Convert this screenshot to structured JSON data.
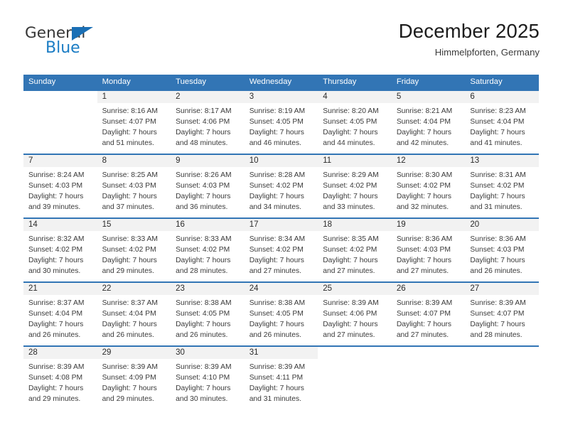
{
  "brand": {
    "name_part1": "General",
    "name_part2": "Blue",
    "accent_color": "#1a7cc4"
  },
  "header": {
    "title": "December 2025",
    "subtitle": "Himmelpforten, Germany"
  },
  "theme": {
    "header_blue": "#3275b5",
    "daynum_band": "#f2f2f2",
    "text": "#3a3a3a"
  },
  "weekday_headers": [
    "Sunday",
    "Monday",
    "Tuesday",
    "Wednesday",
    "Thursday",
    "Friday",
    "Saturday"
  ],
  "weeks": [
    [
      {
        "day": "",
        "sunrise": "",
        "sunset": "",
        "daylight1": "",
        "daylight2": ""
      },
      {
        "day": "1",
        "sunrise": "Sunrise: 8:16 AM",
        "sunset": "Sunset: 4:07 PM",
        "daylight1": "Daylight: 7 hours",
        "daylight2": "and 51 minutes."
      },
      {
        "day": "2",
        "sunrise": "Sunrise: 8:17 AM",
        "sunset": "Sunset: 4:06 PM",
        "daylight1": "Daylight: 7 hours",
        "daylight2": "and 48 minutes."
      },
      {
        "day": "3",
        "sunrise": "Sunrise: 8:19 AM",
        "sunset": "Sunset: 4:05 PM",
        "daylight1": "Daylight: 7 hours",
        "daylight2": "and 46 minutes."
      },
      {
        "day": "4",
        "sunrise": "Sunrise: 8:20 AM",
        "sunset": "Sunset: 4:05 PM",
        "daylight1": "Daylight: 7 hours",
        "daylight2": "and 44 minutes."
      },
      {
        "day": "5",
        "sunrise": "Sunrise: 8:21 AM",
        "sunset": "Sunset: 4:04 PM",
        "daylight1": "Daylight: 7 hours",
        "daylight2": "and 42 minutes."
      },
      {
        "day": "6",
        "sunrise": "Sunrise: 8:23 AM",
        "sunset": "Sunset: 4:04 PM",
        "daylight1": "Daylight: 7 hours",
        "daylight2": "and 41 minutes."
      }
    ],
    [
      {
        "day": "7",
        "sunrise": "Sunrise: 8:24 AM",
        "sunset": "Sunset: 4:03 PM",
        "daylight1": "Daylight: 7 hours",
        "daylight2": "and 39 minutes."
      },
      {
        "day": "8",
        "sunrise": "Sunrise: 8:25 AM",
        "sunset": "Sunset: 4:03 PM",
        "daylight1": "Daylight: 7 hours",
        "daylight2": "and 37 minutes."
      },
      {
        "day": "9",
        "sunrise": "Sunrise: 8:26 AM",
        "sunset": "Sunset: 4:03 PM",
        "daylight1": "Daylight: 7 hours",
        "daylight2": "and 36 minutes."
      },
      {
        "day": "10",
        "sunrise": "Sunrise: 8:28 AM",
        "sunset": "Sunset: 4:02 PM",
        "daylight1": "Daylight: 7 hours",
        "daylight2": "and 34 minutes."
      },
      {
        "day": "11",
        "sunrise": "Sunrise: 8:29 AM",
        "sunset": "Sunset: 4:02 PM",
        "daylight1": "Daylight: 7 hours",
        "daylight2": "and 33 minutes."
      },
      {
        "day": "12",
        "sunrise": "Sunrise: 8:30 AM",
        "sunset": "Sunset: 4:02 PM",
        "daylight1": "Daylight: 7 hours",
        "daylight2": "and 32 minutes."
      },
      {
        "day": "13",
        "sunrise": "Sunrise: 8:31 AM",
        "sunset": "Sunset: 4:02 PM",
        "daylight1": "Daylight: 7 hours",
        "daylight2": "and 31 minutes."
      }
    ],
    [
      {
        "day": "14",
        "sunrise": "Sunrise: 8:32 AM",
        "sunset": "Sunset: 4:02 PM",
        "daylight1": "Daylight: 7 hours",
        "daylight2": "and 30 minutes."
      },
      {
        "day": "15",
        "sunrise": "Sunrise: 8:33 AM",
        "sunset": "Sunset: 4:02 PM",
        "daylight1": "Daylight: 7 hours",
        "daylight2": "and 29 minutes."
      },
      {
        "day": "16",
        "sunrise": "Sunrise: 8:33 AM",
        "sunset": "Sunset: 4:02 PM",
        "daylight1": "Daylight: 7 hours",
        "daylight2": "and 28 minutes."
      },
      {
        "day": "17",
        "sunrise": "Sunrise: 8:34 AM",
        "sunset": "Sunset: 4:02 PM",
        "daylight1": "Daylight: 7 hours",
        "daylight2": "and 27 minutes."
      },
      {
        "day": "18",
        "sunrise": "Sunrise: 8:35 AM",
        "sunset": "Sunset: 4:02 PM",
        "daylight1": "Daylight: 7 hours",
        "daylight2": "and 27 minutes."
      },
      {
        "day": "19",
        "sunrise": "Sunrise: 8:36 AM",
        "sunset": "Sunset: 4:03 PM",
        "daylight1": "Daylight: 7 hours",
        "daylight2": "and 27 minutes."
      },
      {
        "day": "20",
        "sunrise": "Sunrise: 8:36 AM",
        "sunset": "Sunset: 4:03 PM",
        "daylight1": "Daylight: 7 hours",
        "daylight2": "and 26 minutes."
      }
    ],
    [
      {
        "day": "21",
        "sunrise": "Sunrise: 8:37 AM",
        "sunset": "Sunset: 4:04 PM",
        "daylight1": "Daylight: 7 hours",
        "daylight2": "and 26 minutes."
      },
      {
        "day": "22",
        "sunrise": "Sunrise: 8:37 AM",
        "sunset": "Sunset: 4:04 PM",
        "daylight1": "Daylight: 7 hours",
        "daylight2": "and 26 minutes."
      },
      {
        "day": "23",
        "sunrise": "Sunrise: 8:38 AM",
        "sunset": "Sunset: 4:05 PM",
        "daylight1": "Daylight: 7 hours",
        "daylight2": "and 26 minutes."
      },
      {
        "day": "24",
        "sunrise": "Sunrise: 8:38 AM",
        "sunset": "Sunset: 4:05 PM",
        "daylight1": "Daylight: 7 hours",
        "daylight2": "and 26 minutes."
      },
      {
        "day": "25",
        "sunrise": "Sunrise: 8:39 AM",
        "sunset": "Sunset: 4:06 PM",
        "daylight1": "Daylight: 7 hours",
        "daylight2": "and 27 minutes."
      },
      {
        "day": "26",
        "sunrise": "Sunrise: 8:39 AM",
        "sunset": "Sunset: 4:07 PM",
        "daylight1": "Daylight: 7 hours",
        "daylight2": "and 27 minutes."
      },
      {
        "day": "27",
        "sunrise": "Sunrise: 8:39 AM",
        "sunset": "Sunset: 4:07 PM",
        "daylight1": "Daylight: 7 hours",
        "daylight2": "and 28 minutes."
      }
    ],
    [
      {
        "day": "28",
        "sunrise": "Sunrise: 8:39 AM",
        "sunset": "Sunset: 4:08 PM",
        "daylight1": "Daylight: 7 hours",
        "daylight2": "and 29 minutes."
      },
      {
        "day": "29",
        "sunrise": "Sunrise: 8:39 AM",
        "sunset": "Sunset: 4:09 PM",
        "daylight1": "Daylight: 7 hours",
        "daylight2": "and 29 minutes."
      },
      {
        "day": "30",
        "sunrise": "Sunrise: 8:39 AM",
        "sunset": "Sunset: 4:10 PM",
        "daylight1": "Daylight: 7 hours",
        "daylight2": "and 30 minutes."
      },
      {
        "day": "31",
        "sunrise": "Sunrise: 8:39 AM",
        "sunset": "Sunset: 4:11 PM",
        "daylight1": "Daylight: 7 hours",
        "daylight2": "and 31 minutes."
      },
      {
        "day": "",
        "sunrise": "",
        "sunset": "",
        "daylight1": "",
        "daylight2": ""
      },
      {
        "day": "",
        "sunrise": "",
        "sunset": "",
        "daylight1": "",
        "daylight2": ""
      },
      {
        "day": "",
        "sunrise": "",
        "sunset": "",
        "daylight1": "",
        "daylight2": ""
      }
    ]
  ]
}
